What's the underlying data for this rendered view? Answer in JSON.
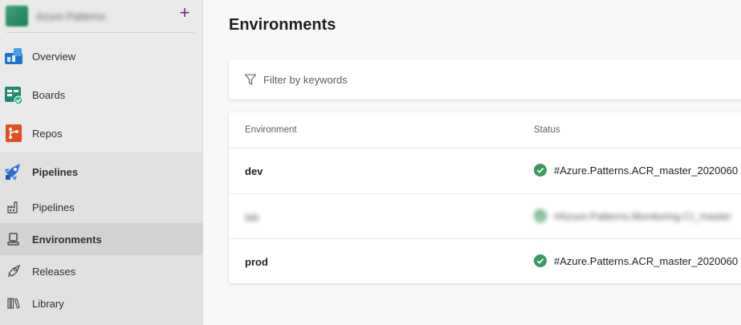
{
  "sidebar": {
    "project_name": "Azure Patterns",
    "add_label": "+",
    "items": [
      {
        "label": "Overview",
        "icon": "overview-icon"
      },
      {
        "label": "Boards",
        "icon": "boards-icon"
      },
      {
        "label": "Repos",
        "icon": "repos-icon"
      },
      {
        "label": "Pipelines",
        "icon": "pipelines-rocket-icon"
      }
    ],
    "sub_items": [
      {
        "label": "Pipelines",
        "icon": "pipelines-factory-icon"
      },
      {
        "label": "Environments",
        "icon": "environments-icon",
        "selected": true
      },
      {
        "label": "Releases",
        "icon": "releases-rocket-icon"
      },
      {
        "label": "Library",
        "icon": "library-icon"
      }
    ]
  },
  "main": {
    "title": "Environments",
    "filter_placeholder": "Filter by keywords",
    "columns": [
      "Environment",
      "Status"
    ],
    "rows": [
      {
        "environment": "dev",
        "status": "#Azure.Patterns.ACR_master_2020060",
        "state": "succeeded"
      },
      {
        "environment": "lab",
        "status": "#Azure.Patterns.Monitoring.CI_master",
        "state": "succeeded",
        "blurred": true
      },
      {
        "environment": "prod",
        "status": "#Azure.Patterns.ACR_master_2020060",
        "state": "succeeded"
      }
    ]
  },
  "colors": {
    "success": "#3c9a5f",
    "accent_purple": "#6b2f8a",
    "sidebar_bg": "#eaeaea",
    "selected_bg": "#d2d2d2"
  }
}
